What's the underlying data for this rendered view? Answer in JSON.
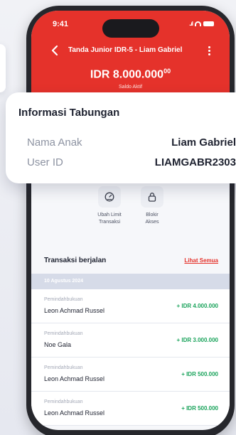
{
  "status_bar": {
    "time": "9:41",
    "signal": "..ıl"
  },
  "header": {
    "title": "Tanda Junior IDR-5 - Liam Gabriel",
    "balance": "IDR 8.000.000",
    "balance_decimals": "00",
    "balance_label": "Saldo Aktif"
  },
  "info_card": {
    "title": "Informasi Tabungan",
    "rows": [
      {
        "label": "Nama Anak",
        "value": "Liam Gabriel"
      },
      {
        "label": "User ID",
        "value": "LIAMGABR2303"
      }
    ]
  },
  "actions": [
    {
      "label_line1": "Ubah Limit",
      "label_line2": "Transaksi",
      "icon": "gauge-icon"
    },
    {
      "label_line1": "Blokir",
      "label_line2": "Akses",
      "icon": "lock-icon"
    }
  ],
  "transactions": {
    "title": "Transaksi berjalan",
    "see_all": "Lihat Semua",
    "date": "10 Agustus 2024",
    "items": [
      {
        "type": "Pemindahbukuan",
        "name": "Leon Achmad Russel",
        "amount": "+ IDR 4.000.000"
      },
      {
        "type": "Pemindahbukuan",
        "name": "Noe Gala",
        "amount": "+ IDR 3.000.000"
      },
      {
        "type": "Pemindahbukuan",
        "name": "Leon Achmad Russel",
        "amount": "+ IDR 500.000"
      },
      {
        "type": "Pemindahbukuan",
        "name": "Leon Achmad Russel",
        "amount": "+ IDR 500.000"
      }
    ]
  },
  "colors": {
    "brand_red": "#e5322b",
    "credit_green": "#1aa35b"
  }
}
